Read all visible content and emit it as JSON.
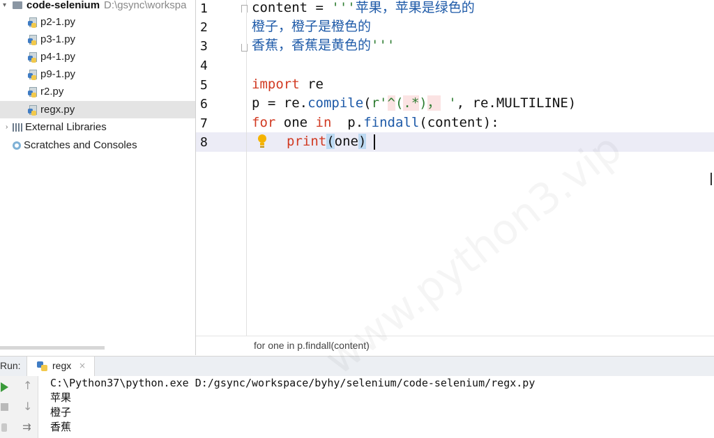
{
  "project_tree": {
    "root_name": "code-selenium",
    "root_path": "D:\\gsync\\workspa",
    "files": [
      "p2-1.py",
      "p3-1.py",
      "p4-1.py",
      "p9-1.py",
      "r2.py",
      "regx.py"
    ],
    "selected_file": "regx.py",
    "external_libraries": "External Libraries",
    "scratches": "Scratches and Consoles"
  },
  "editor": {
    "line_numbers": [
      "1",
      "2",
      "3",
      "4",
      "5",
      "6",
      "7",
      "8"
    ],
    "current_line": "8",
    "lines": {
      "l1_a": "content = ",
      "l1_b": "'''",
      "l1_c": "苹果，苹果是绿色的",
      "l2": "橙子，橙子是橙色的",
      "l3_a": "香蕉，香蕉是黄色的",
      "l3_b": "'''",
      "l5_a": "import",
      "l5_b": " re",
      "l6_a": "p = re.",
      "l6_b": "compile",
      "l6_c": "(",
      "l6_d": "r'",
      "l6_e": "^",
      "l6_f": "(",
      "l6_g": ".*",
      "l6_h": ")",
      "l6_i": "，",
      "l6_j": " '",
      "l6_k": ", re.MULTILINE)",
      "l7_a": "for",
      "l7_b": " one ",
      "l7_c": "in",
      "l7_d": "  p.",
      "l7_e": "findall",
      "l7_f": "(content):",
      "l8_a": "print",
      "l8_b": "(",
      "l8_c": "one",
      "l8_d": ")"
    }
  },
  "breadcrumb": "for one in p.findall(content)",
  "run_panel": {
    "label": "Run:",
    "tab_name": "regx",
    "output": [
      "C:\\Python37\\python.exe D:/gsync/workspace/byhy/selenium/code-selenium/regx.py",
      "苹果",
      "橙子",
      "香蕉"
    ]
  },
  "watermark": "www.python3.vip",
  "colors": {
    "keyword": "#d13a22",
    "function": "#1e5aa8",
    "string": "#2f7d32",
    "selection": "#e4e4e4",
    "current_line": "#ececf6"
  }
}
